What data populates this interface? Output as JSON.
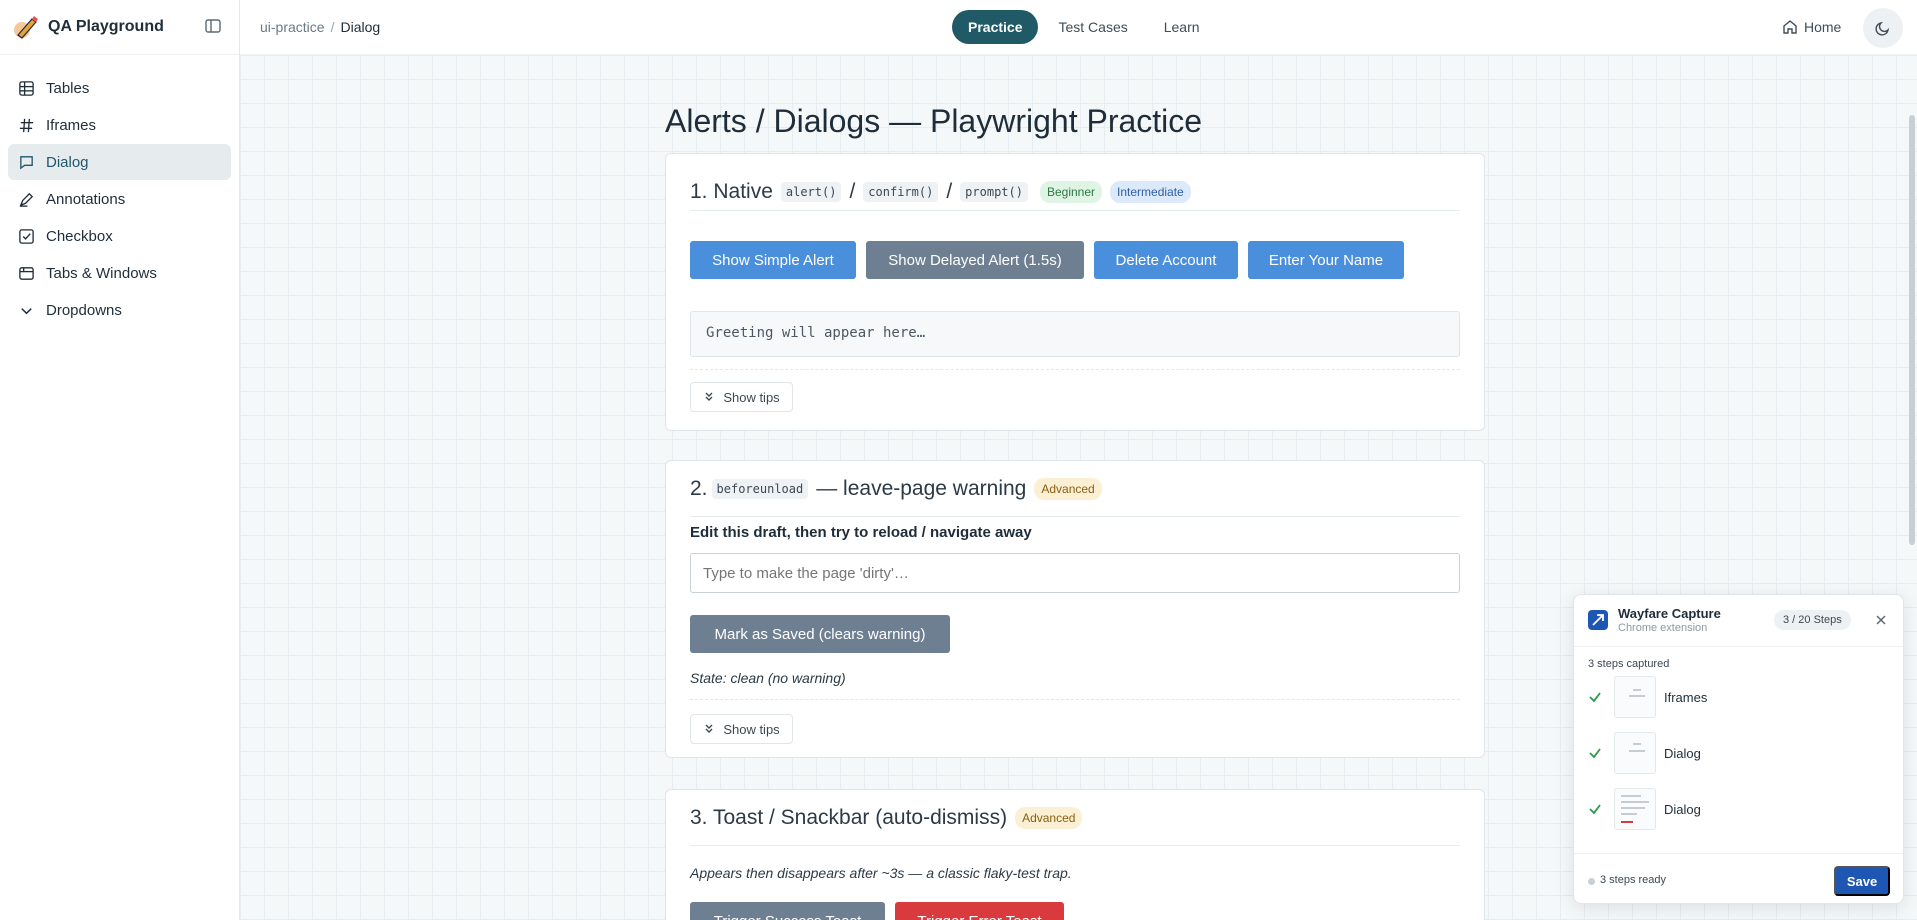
{
  "app": {
    "name": "QA Playground"
  },
  "sidebar": {
    "items": [
      {
        "label": "Tables",
        "icon": "table-icon"
      },
      {
        "label": "Iframes",
        "icon": "hash-icon"
      },
      {
        "label": "Dialog",
        "icon": "message-square-icon",
        "active": true
      },
      {
        "label": "Annotations",
        "icon": "pen-icon"
      },
      {
        "label": "Checkbox",
        "icon": "checkbox-icon"
      },
      {
        "label": "Tabs & Windows",
        "icon": "browser-window-icon"
      },
      {
        "label": "Dropdowns",
        "icon": "chevron-down-icon"
      }
    ]
  },
  "breadcrumb": {
    "root": "ui-practice",
    "separator": "/",
    "current": "Dialog"
  },
  "top_nav": {
    "tabs": [
      "Practice",
      "Test Cases",
      "Learn"
    ],
    "active": "Practice",
    "home": "Home"
  },
  "page": {
    "title": "Alerts / Dialogs — Playwright Practice"
  },
  "section1": {
    "number": "1. Native",
    "code1": "alert()",
    "slash": "/",
    "code2": "confirm()",
    "code3": "prompt()",
    "badges": [
      "Beginner",
      "Intermediate"
    ],
    "buttons": [
      "Show Simple Alert",
      "Show Delayed Alert (1.5s)",
      "Delete Account",
      "Enter Your Name"
    ],
    "greeting": "Greeting will appear here…",
    "tips": "Show tips"
  },
  "section2": {
    "number": "2.",
    "code": "beforeunload",
    "title_rest": "— leave-page warning",
    "badge": "Advanced",
    "field_label": "Edit this draft, then try to reload / navigate away",
    "placeholder": "Type to make the page 'dirty'…",
    "button": "Mark as Saved (clears warning)",
    "state": "State: clean (no warning)",
    "tips": "Show tips"
  },
  "section3": {
    "title": "3. Toast / Snackbar (auto-dismiss)",
    "badge": "Advanced",
    "description": "Appears then disappears after ~3s — a classic flaky-test trap.",
    "buttons": [
      "Trigger Success Toast",
      "Trigger Error Toast"
    ]
  },
  "extension": {
    "title": "Wayfare Capture",
    "subtitle": "Chrome extension",
    "step_count": "3 / 20 Steps",
    "captured": "3 steps captured",
    "steps": [
      "Iframes",
      "Dialog",
      "Dialog"
    ],
    "ready": "3 steps ready",
    "save": "Save"
  },
  "colors": {
    "accent": "#1f5a66",
    "primary_button": "#4a8fdb",
    "secondary_button": "#6e7f92",
    "danger_button": "#d93a3e",
    "extension_brand": "#1e56b3"
  }
}
